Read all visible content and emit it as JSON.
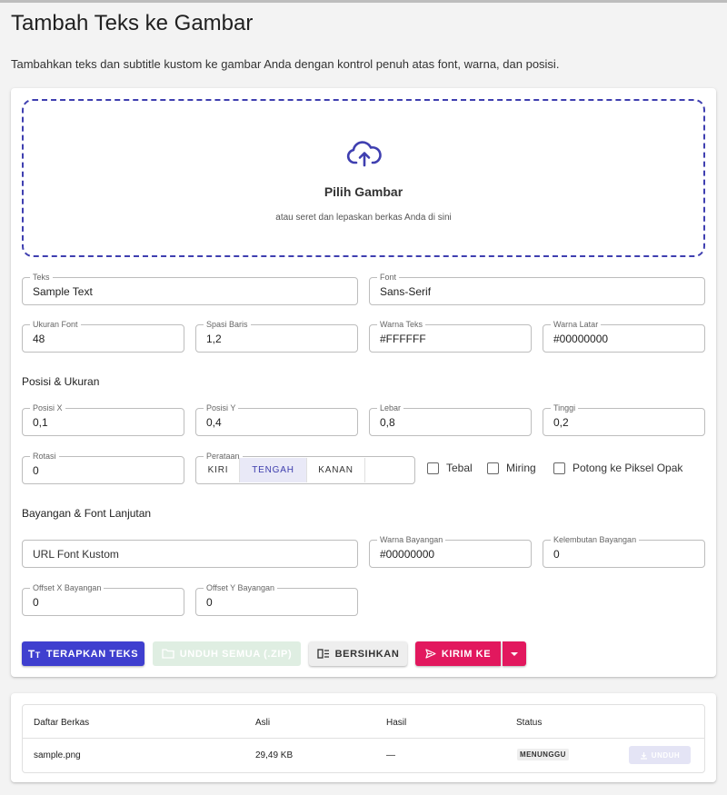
{
  "page": {
    "title": "Tambah Teks ke Gambar",
    "description": "Tambahkan teks dan subtitle kustom ke gambar Anda dengan kontrol penuh atas font, warna, dan posisi."
  },
  "dropzone": {
    "title": "Pilih Gambar",
    "subtitle": "atau seret dan lepaskan berkas Anda di sini",
    "icon": "cloud-upload-icon"
  },
  "fields": {
    "text": {
      "label": "Teks",
      "value": "Sample Text"
    },
    "font": {
      "label": "Font",
      "value": "Sans-Serif"
    },
    "font_size": {
      "label": "Ukuran Font",
      "value": "48"
    },
    "line_spacing": {
      "label": "Spasi Baris",
      "value": "1,2"
    },
    "text_color": {
      "label": "Warna Teks",
      "value": "#FFFFFF"
    },
    "bg_color": {
      "label": "Warna Latar",
      "value": "#00000000"
    },
    "pos_x": {
      "label": "Posisi X",
      "value": "0,1"
    },
    "pos_y": {
      "label": "Posisi Y",
      "value": "0,4"
    },
    "width": {
      "label": "Lebar",
      "value": "0,8"
    },
    "height": {
      "label": "Tinggi",
      "value": "0,2"
    },
    "rotation": {
      "label": "Rotasi",
      "value": "0"
    },
    "custom_font_url": {
      "placeholder": "URL Font Kustom"
    },
    "shadow_color": {
      "label": "Warna Bayangan",
      "value": "#00000000"
    },
    "shadow_blur": {
      "label": "Kelembutan Bayangan",
      "value": "0"
    },
    "shadow_offset_x": {
      "label": "Offset X Bayangan",
      "value": "0"
    },
    "shadow_offset_y": {
      "label": "Offset Y Bayangan",
      "value": "0"
    }
  },
  "sections": {
    "position": "Posisi & Ukuran",
    "shadow": "Bayangan & Font Lanjutan"
  },
  "alignment": {
    "label": "Perataan",
    "options": [
      "KIRI",
      "TENGAH",
      "KANAN"
    ],
    "selected": "TENGAH"
  },
  "checkboxes": {
    "bold": "Tebal",
    "italic": "Miring",
    "crop": "Potong ke Piksel Opak"
  },
  "buttons": {
    "apply": "TERAPKAN TEKS",
    "download_all": "UNDUH SEMUA (.ZIP)",
    "clear": "BERSIHKAN",
    "send_to": "KIRIM KE"
  },
  "file_table": {
    "headers": [
      "Daftar Berkas",
      "Asli",
      "Hasil",
      "Status"
    ],
    "rows": [
      {
        "name": "sample.png",
        "original": "29,49 KB",
        "result": "—",
        "status": "MENUNGGU",
        "action": "UNDUH"
      }
    ]
  },
  "colors": {
    "primary": "#3f3fcf",
    "accent": "#e2185e",
    "dropzone_border": "#3f3fb0"
  }
}
